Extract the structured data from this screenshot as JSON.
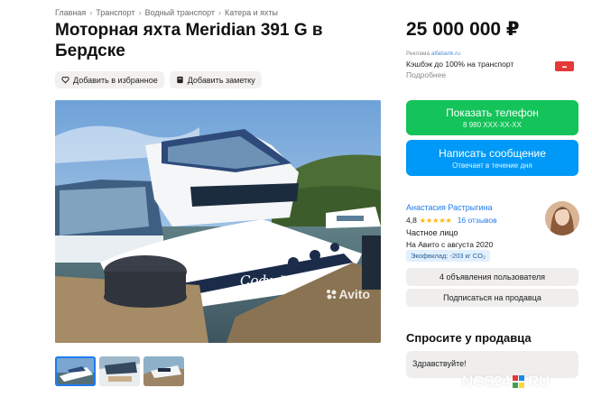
{
  "breadcrumb": [
    "Главная",
    "Транспорт",
    "Водный транспорт",
    "Катера и яхты"
  ],
  "title": "Моторная яхта Meridian 391 G в Бердске",
  "actions": {
    "favorite_label": "Добавить в избранное",
    "note_label": "Добавить заметку"
  },
  "gallery": {
    "watermark": "Avito",
    "boat_name": "Софий",
    "thumb_count": 3
  },
  "price": "25 000 000 ₽",
  "ad": {
    "label": "Реклама",
    "domain": "alfabank.ru",
    "text": "Кэшбэк до 100% на транспорт",
    "more": "Подробнее"
  },
  "phone_button": {
    "label": "Показать телефон",
    "number": "8 980 XXX-XX-XX"
  },
  "message_button": {
    "label": "Написать сообщение",
    "sub": "Отвечает в течение дня"
  },
  "seller": {
    "name": "Анастасия Растрыгина",
    "rating": "4,8",
    "stars": "★★★★★",
    "reviews": "16 отзывов",
    "type": "Частное лицо",
    "since": "На Авито с августа 2020",
    "eco": "Экофвклад: -203 кг CO₂"
  },
  "seller_buttons": {
    "ads": "4 объявления пользователя",
    "subscribe": "Подписаться на продавца"
  },
  "ask": {
    "title": "Спросите у продавца",
    "value": "Здравствуйте!"
  },
  "overlay_logo": {
    "text_left": "NGS24",
    "text_right": "RU"
  },
  "colors": {
    "phone_green": "#14c35a",
    "message_blue": "#0099f7",
    "link_blue": "#1f7bf0",
    "star_yellow": "#ffb400"
  }
}
